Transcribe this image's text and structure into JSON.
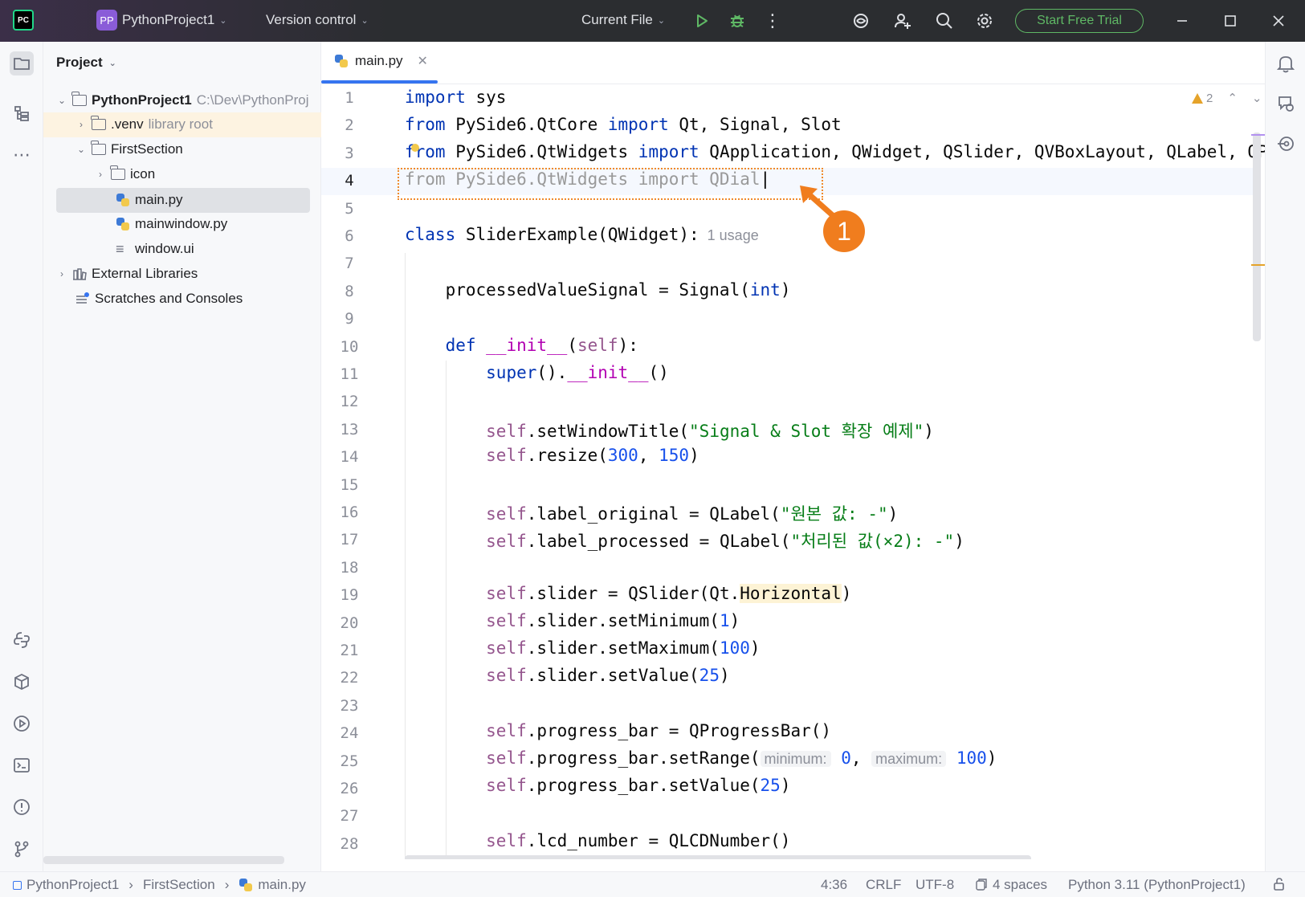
{
  "titlebar": {
    "project_badge": "PP",
    "project_name": "PythonProject1",
    "vcs_label": "Version control",
    "run_config": "Current File",
    "trial_button": "Start Free Trial",
    "logo_text": "PC"
  },
  "project_panel": {
    "title": "Project",
    "tree": [
      {
        "label": "PythonProject1",
        "hint": "C:\\Dev\\PythonProj",
        "type": "folder",
        "expanded": true
      },
      {
        "label": ".venv",
        "hint": "library root",
        "type": "folder",
        "expanded": false
      },
      {
        "label": "FirstSection",
        "hint": "",
        "type": "folder",
        "expanded": true
      },
      {
        "label": "icon",
        "hint": "",
        "type": "folder",
        "expanded": false
      },
      {
        "label": "main.py",
        "hint": "",
        "type": "python-file",
        "selected": true
      },
      {
        "label": "mainwindow.py",
        "hint": "",
        "type": "python-file"
      },
      {
        "label": "window.ui",
        "hint": "",
        "type": "ui-file"
      },
      {
        "label": "External Libraries",
        "hint": "",
        "type": "library",
        "expanded": false
      },
      {
        "label": "Scratches and Consoles",
        "hint": "",
        "type": "scratches"
      }
    ]
  },
  "editor": {
    "tab_label": "main.py",
    "warning_count": "2",
    "callout_number": "1",
    "lines": [
      "1",
      "2",
      "3",
      "4",
      "5",
      "6",
      "7",
      "8",
      "9",
      "10",
      "11",
      "12",
      "13",
      "14",
      "15",
      "16",
      "17",
      "18",
      "19",
      "20",
      "21",
      "22",
      "23",
      "24",
      "25",
      "26",
      "27",
      "28"
    ],
    "current_line": "4",
    "usage_hint": "1 usage",
    "param_hint_min": "minimum:",
    "param_hint_max": "maximum:"
  },
  "statusbar": {
    "breadcrumb": [
      "PythonProject1",
      "FirstSection",
      "main.py"
    ],
    "position": "4:36",
    "line_ending": "CRLF",
    "encoding": "UTF-8",
    "indent": "4 spaces",
    "interpreter": "Python 3.11 (PythonProject1)"
  },
  "colors": {
    "accent": "#3574f0",
    "callout": "#f07d1e",
    "trial": "#5fb865"
  }
}
